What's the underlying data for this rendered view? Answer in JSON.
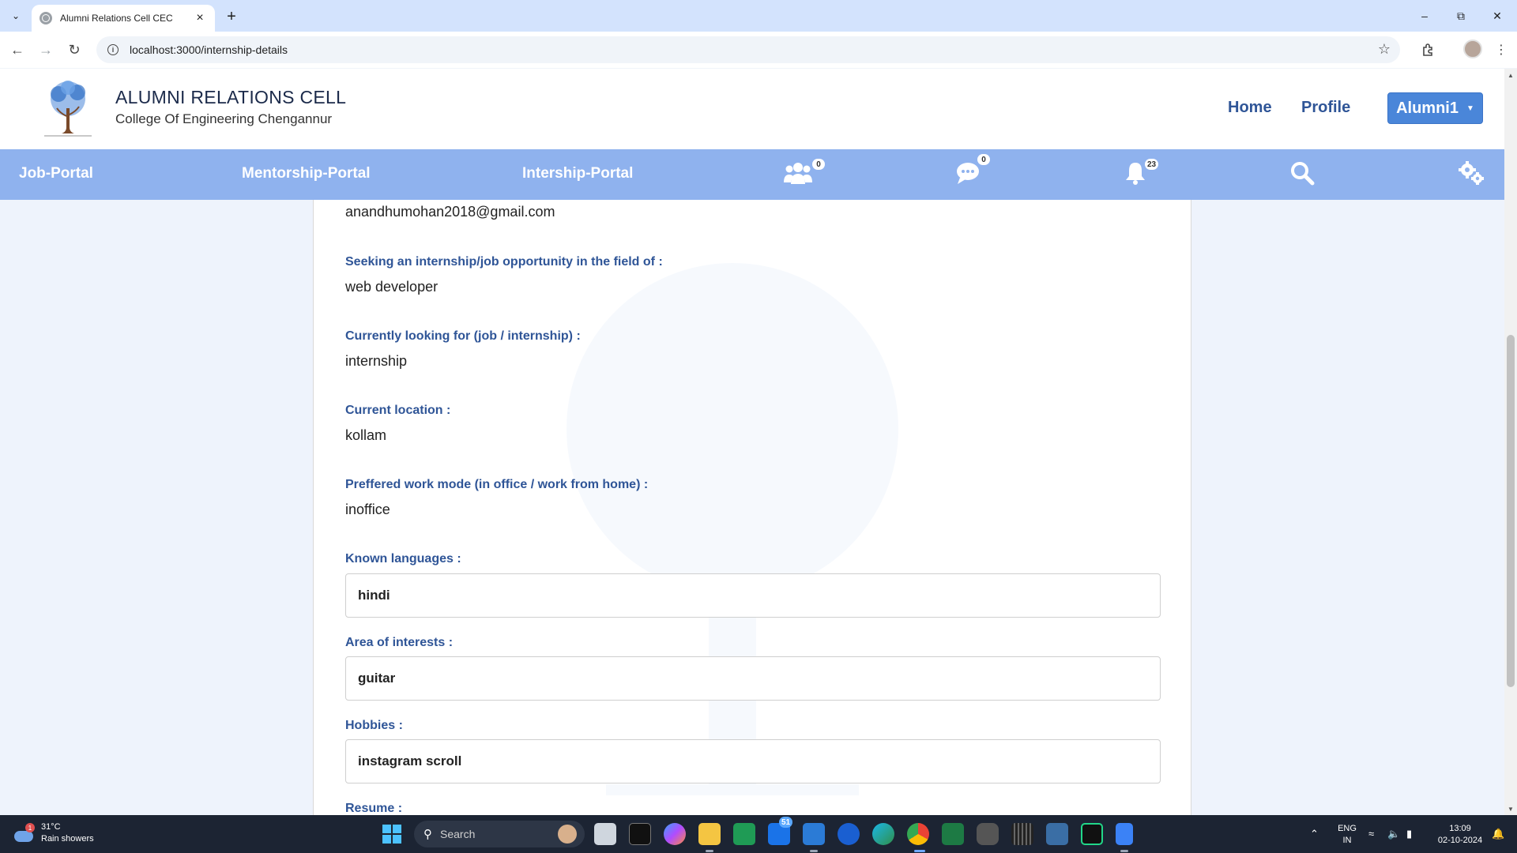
{
  "browser": {
    "tab_title": "Alumni Relations Cell CEC",
    "url": "localhost:3000/internship-details"
  },
  "header": {
    "title": "ALUMNI RELATIONS CELL",
    "subtitle": "College Of Engineering Chengannur",
    "home_label": "Home",
    "profile_label": "Profile",
    "user_menu_label": "Alumni1"
  },
  "portal_nav": {
    "job_portal": "Job-Portal",
    "mentorship_portal": "Mentorship-Portal",
    "internship_portal": "Intership-Portal",
    "connections_count": "0",
    "messages_count": "0",
    "notifications_count": "23"
  },
  "details": {
    "email_value": "anandhumohan2018@gmail.com",
    "field_label": "Seeking an internship/job opportunity in the field of :",
    "field_value": "web developer",
    "looking_for_label": "Currently looking for (job / internship) :",
    "looking_for_value": "internship",
    "location_label": "Current location :",
    "location_value": "kollam",
    "work_mode_label": "Preffered work mode (in office / work from home) :",
    "work_mode_value": "inoffice",
    "languages_label": "Known languages :",
    "languages_value": "hindi",
    "interests_label": "Area of interests :",
    "interests_value": "guitar",
    "hobbies_label": "Hobbies :",
    "hobbies_value": "instagram scroll",
    "resume_label": "Resume :"
  },
  "taskbar": {
    "temperature": "31°C",
    "weather": "Rain showers",
    "weather_badge": "1",
    "search_label": "Search",
    "mail_badge": "51",
    "lang_top": "ENG",
    "lang_bottom": "IN",
    "time": "13:09",
    "date": "02-10-2024"
  },
  "colors": {
    "nav_blue": "#8fb2ee",
    "accent": "#4a86d9",
    "label_blue": "#2f5597"
  }
}
